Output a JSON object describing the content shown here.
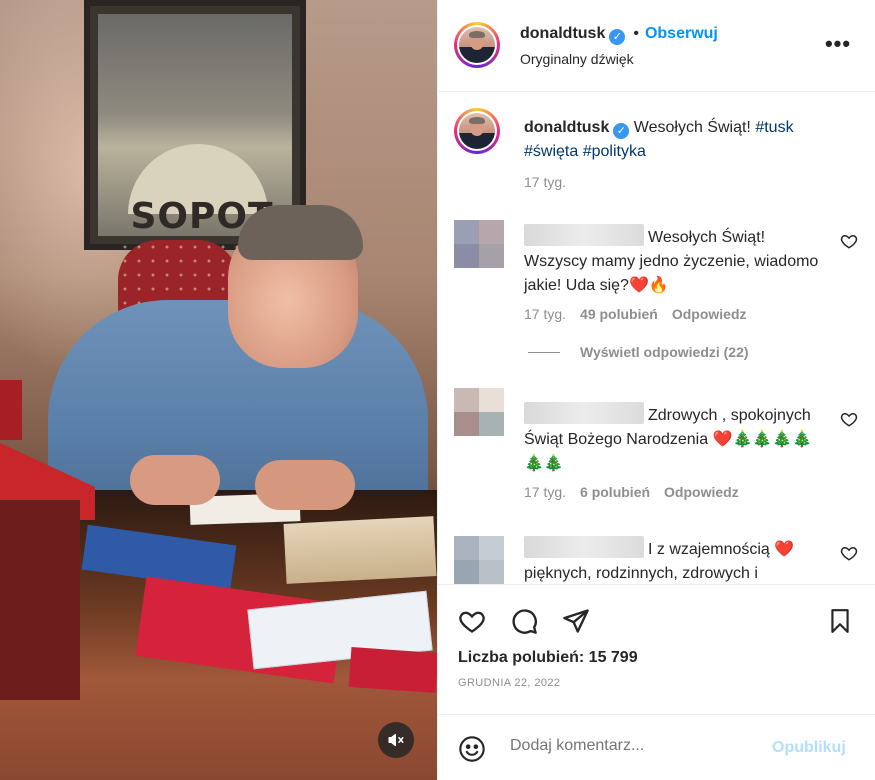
{
  "post_header": {
    "username": "donaldtusk",
    "follow_label": "Obserwuj",
    "separator": "•",
    "audio_label": "Oryginalny dźwięk",
    "more_label": "•••"
  },
  "media": {
    "poster_text": "SOPOT"
  },
  "caption": {
    "username": "donaldtusk",
    "text": "Wesołych Świąt!",
    "hashtags": [
      "#tusk",
      "#święta",
      "#polityka"
    ],
    "time": "17 tyg."
  },
  "comments": [
    {
      "text": "Wesołych Świąt! Wszyscy mamy jedno życzenie, wiadomo jakie! Uda się?❤️🔥",
      "time": "17 tyg.",
      "likes": "49 polubień",
      "reply_label": "Odpowiedz",
      "view_replies": "Wyświetl odpowiedzi (22)"
    },
    {
      "text": "Zdrowych , spokojnych Świąt Bożego Narodzenia ❤️🎄🎄🎄🎄🎄🎄",
      "time": "17 tyg.",
      "likes": "6 polubień",
      "reply_label": "Odpowiedz"
    },
    {
      "text": "I z wzajemnością ❤️ pięknych, rodzinnych, zdrowych i"
    }
  ],
  "actions": {
    "likes_label": "Liczba polubień: 15 799",
    "date": "GRUDNIA 22, 2022"
  },
  "add_comment": {
    "placeholder": "Dodaj komentarz...",
    "publish_label": "Opublikuj"
  },
  "colors": {
    "accent_blue": "#0095f6",
    "verified_blue": "#3897f0",
    "publish_disabled": "#b2dffc",
    "muted_text": "#8e8e8e",
    "heart_red": "#e0242f"
  }
}
